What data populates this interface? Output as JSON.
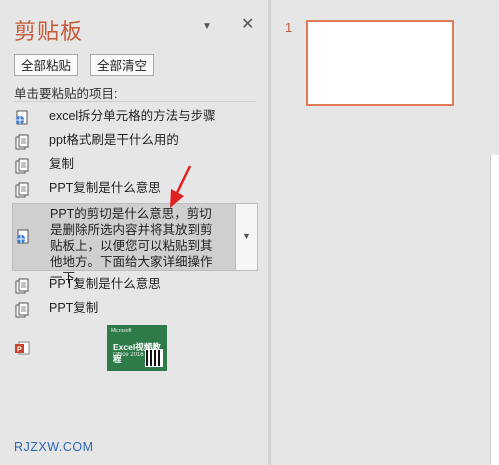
{
  "clipboard_pane": {
    "title": "剪贴板",
    "pin_icon": "chevron-down-icon",
    "close_icon": "close-icon",
    "paste_all_label": "全部粘贴",
    "clear_all_label": "全部清空",
    "hint": "单击要粘贴的项目:",
    "items": [
      {
        "icon": "web-doc-icon",
        "text": "excel拆分单元格的方法与步骤"
      },
      {
        "icon": "doc-icon",
        "text": "ppt格式刷是干什么用的"
      },
      {
        "icon": "doc-icon",
        "text": "复制"
      },
      {
        "icon": "doc-icon",
        "text": "PPT复制是什么意思"
      },
      {
        "icon": "web-doc-icon",
        "text": "PPT的剪切是什么意思，剪切是删除所选内容并将其放到剪贴板上，以便您可以粘贴到其他地方。下面给大家详细操作一下。",
        "selected": true
      },
      {
        "icon": "doc-icon",
        "text": "PPT复制是什么意思"
      },
      {
        "icon": "doc-icon",
        "text": "PPT复制"
      }
    ],
    "image_item": {
      "icon": "powerpoint-icon",
      "thumb_title": "Excel视频教程",
      "thumb_sub": "Office 2016",
      "thumb_logo": "Microsoft"
    },
    "watermark": "RJZXW.COM"
  },
  "slides_panel": {
    "slide_number": "1"
  },
  "colors": {
    "accent": "#c55a3a",
    "slide_border": "#e07a58",
    "pane_bg": "#e6e6e6",
    "selected_bg": "#cfcfcf",
    "arrow": "#e02020"
  }
}
